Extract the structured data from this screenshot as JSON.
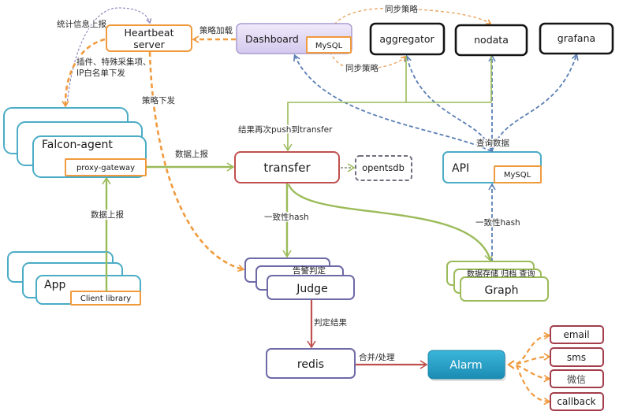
{
  "colors": {
    "orange": "#f09a3e",
    "teal": "#4bacc6",
    "red": "#c0504d",
    "purple": "#6e6aa8",
    "green": "#9bbb59",
    "blue": "#5b7fb5",
    "gray": "#6f6f7f",
    "black": "#141414",
    "channel": "#a33d4b",
    "alarm": "#2a9fc6"
  },
  "nodes": {
    "heartbeat": {
      "line1": "Heartbeat",
      "line2": "server"
    },
    "dashboard": {
      "label": "Dashboard",
      "db": "MySQL"
    },
    "aggregator": {
      "label": "aggregator"
    },
    "nodata": {
      "label": "nodata"
    },
    "grafana": {
      "label": "grafana"
    },
    "falcon_agent": {
      "label": "Falcon-agent",
      "module": "proxy-gateway"
    },
    "app": {
      "label": "App",
      "module": "Client library"
    },
    "transfer": {
      "label": "transfer"
    },
    "opentsdb": {
      "label": "opentsdb"
    },
    "api": {
      "label": "API",
      "db": "MySQL"
    },
    "judge": {
      "label": "Judge",
      "role": "告警判定"
    },
    "graph": {
      "label": "Graph",
      "role": "数据存储 归档 查询"
    },
    "redis": {
      "label": "redis"
    },
    "alarm": {
      "label": "Alarm"
    }
  },
  "channels": [
    {
      "label": "email"
    },
    {
      "label": "sms"
    },
    {
      "label": "微信"
    },
    {
      "label": "callback"
    }
  ],
  "edges": [
    {
      "from": "falcon_agent",
      "to": "heartbeat",
      "label": "统计信息上报"
    },
    {
      "from": "heartbeat",
      "to": "falcon_agent",
      "label_lines": [
        "插件、特殊采集项、",
        "IP白名单下发"
      ]
    },
    {
      "from": "dashboard",
      "to": "heartbeat",
      "label": "策略加载"
    },
    {
      "from": "heartbeat",
      "to": "judge",
      "label": "策略下发"
    },
    {
      "from": "dashboard",
      "to": "nodata",
      "label": "同步策略"
    },
    {
      "from": "dashboard",
      "to": "aggregator",
      "label": "同步策略"
    },
    {
      "from": "aggregator+nodata",
      "to": "transfer",
      "label": "结果再次push到transfer"
    },
    {
      "from": "falcon_agent",
      "to": "transfer",
      "label": "数据上报"
    },
    {
      "from": "app",
      "to": "falcon_agent",
      "label": "数据上报"
    },
    {
      "from": "transfer",
      "to": "opentsdb",
      "label": ""
    },
    {
      "from": "transfer",
      "to": "judge",
      "label": "一致性hash"
    },
    {
      "from": "transfer",
      "to": "graph",
      "label": ""
    },
    {
      "from": "graph",
      "to": "api",
      "label": "一致性hash"
    },
    {
      "from": "api",
      "to": "dashboard+aggregator+nodata+grafana",
      "label": "查询数据"
    },
    {
      "from": "judge",
      "to": "redis",
      "label": "判定结果"
    },
    {
      "from": "redis",
      "to": "alarm",
      "label": "合并/处理"
    },
    {
      "from": "alarm",
      "to": "email+sms+微信+callback",
      "label": ""
    }
  ]
}
